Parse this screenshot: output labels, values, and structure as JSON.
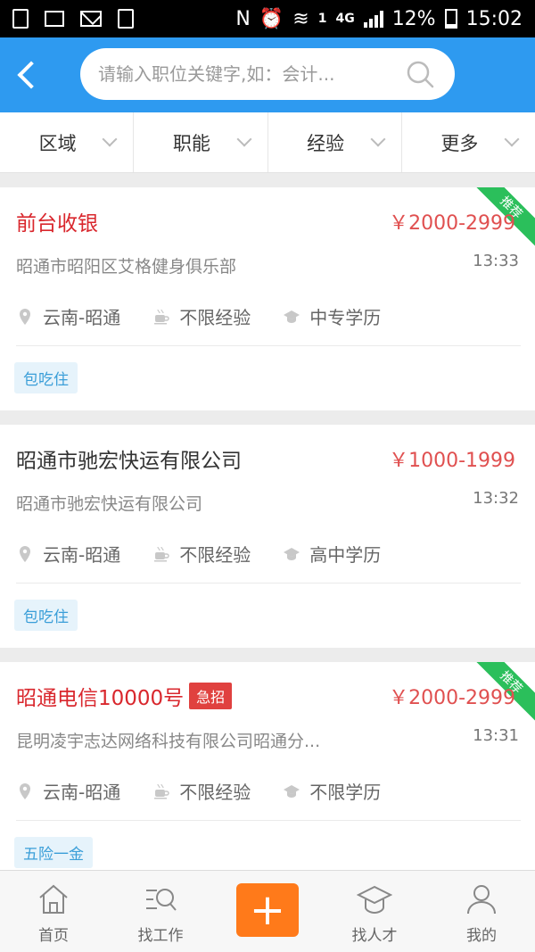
{
  "status_bar": {
    "network_type": "4G",
    "sim_slot": "1",
    "battery": "12%",
    "time": "15:02",
    "nfc_letter": "N"
  },
  "search": {
    "placeholder": "请输入职位关键字,如：会计..."
  },
  "filters": [
    {
      "label": "区域"
    },
    {
      "label": "职能"
    },
    {
      "label": "经验"
    },
    {
      "label": "更多"
    }
  ],
  "jobs": [
    {
      "title": "前台收银",
      "salary": "￥2000-2999",
      "company": "昭通市昭阳区艾格健身俱乐部",
      "time": "13:33",
      "location": "云南-昭通",
      "experience": "不限经验",
      "education": "中专学历",
      "benefit": "包吃住",
      "recommended": "推荐"
    },
    {
      "title": "昭通市驰宏快运有限公司",
      "salary": "￥1000-1999",
      "company": "昭通市驰宏快运有限公司",
      "time": "13:32",
      "location": "云南-昭通",
      "experience": "不限经验",
      "education": "高中学历",
      "benefit": "包吃住"
    },
    {
      "title": "昭通电信10000号",
      "urgent": "急招",
      "salary": "￥2000-2999",
      "company": "昆明凌宇志达网络科技有限公司昭通分...",
      "time": "13:31",
      "location": "云南-昭通",
      "experience": "不限经验",
      "education": "不限学历",
      "benefit": "五险一金",
      "recommended": "推荐"
    }
  ],
  "bottom_nav": {
    "home": "首页",
    "find_job": "找工作",
    "plus": "+",
    "find_talent": "找人才",
    "mine": "我的"
  },
  "colors": {
    "primary_blue": "#2e9af0",
    "salary_red": "#e05050",
    "title_red": "#d9272d",
    "recommend_green": "#2bbf5b",
    "plus_orange": "#ff7a1a"
  }
}
